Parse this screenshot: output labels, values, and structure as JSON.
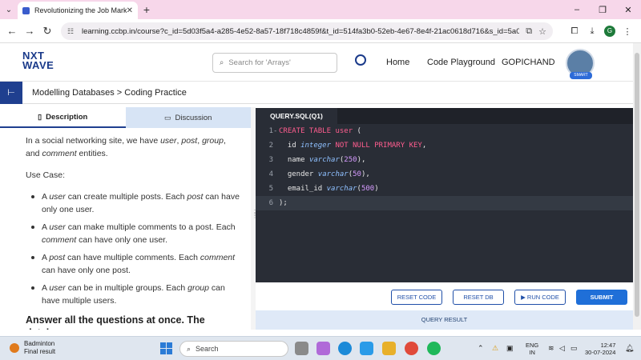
{
  "browser": {
    "tab_title": "Revolutionizing the Job Market",
    "url": "learning.ccbp.in/course?c_id=5d03f5a4-a285-4e52-8a57-18f718c4859f&t_id=514fa3b0-52eb-4e67-8e4f-21ac0618d716&s_id=5a0f436b-85...",
    "profile_initial": "G"
  },
  "header": {
    "logo_line1": "NXT",
    "logo_line2": "WAVE",
    "search_placeholder": "Search for 'Arrays'",
    "nav": [
      "Home",
      "Code Playground",
      "GOPICHAND"
    ],
    "avatar_badge": "SMART"
  },
  "breadcrumb": "Modelling Databases > Coding Practice",
  "left_tabs": [
    "Description",
    "Discussion"
  ],
  "description": {
    "intro_parts": [
      "In a social networking site, we have ",
      "user",
      ", ",
      "post",
      ", ",
      "group",
      ",",
      " and ",
      "comment",
      " entities."
    ],
    "use_case_label": "Use Case:",
    "bullets": [
      [
        "A ",
        "user",
        " can create multiple posts. Each ",
        "post",
        " can have only one user."
      ],
      [
        "A ",
        "user",
        " can make multiple comments to a post. Each ",
        "comment",
        " can have only one user."
      ],
      [
        "A ",
        "post",
        " can have multiple comments. Each ",
        "comment",
        " can have only one post."
      ],
      [
        "A ",
        "user",
        " can be in multiple groups. Each ",
        "group",
        " can have multiple users."
      ]
    ],
    "cut_heading": "Answer all the questions at once. The database"
  },
  "editor": {
    "tab": "QUERY.SQL(Q1)",
    "lines": [
      [
        {
          "t": "CREATE TABLE ",
          "c": "kw"
        },
        {
          "t": "user",
          "c": "kw"
        },
        {
          "t": " (",
          "c": ""
        }
      ],
      [
        {
          "t": "  id ",
          "c": ""
        },
        {
          "t": "integer",
          "c": "ty"
        },
        {
          "t": " NOT NULL PRIMARY KEY",
          "c": "kw"
        },
        {
          "t": ",",
          "c": ""
        }
      ],
      [
        {
          "t": "  name ",
          "c": ""
        },
        {
          "t": "varchar",
          "c": "ty"
        },
        {
          "t": "(",
          "c": ""
        },
        {
          "t": "250",
          "c": "nm"
        },
        {
          "t": "),",
          "c": ""
        }
      ],
      [
        {
          "t": "  gender ",
          "c": ""
        },
        {
          "t": "varchar",
          "c": "ty"
        },
        {
          "t": "(",
          "c": ""
        },
        {
          "t": "50",
          "c": "nm"
        },
        {
          "t": "),",
          "c": ""
        }
      ],
      [
        {
          "t": "  email_id ",
          "c": ""
        },
        {
          "t": "varchar",
          "c": "ty"
        },
        {
          "t": "(",
          "c": ""
        },
        {
          "t": "500",
          "c": "nm"
        },
        {
          "t": ")",
          "c": ""
        }
      ],
      [
        {
          "t": ");",
          "c": ""
        }
      ]
    ]
  },
  "buttons": {
    "reset_code": "RESET CODE",
    "reset_db": "RESET DB",
    "run_code": "RUN CODE",
    "submit": "SUBMIT"
  },
  "query_result": "QUERY RESULT",
  "taskbar": {
    "weather_title": "Badminton",
    "weather_sub": "Final result",
    "search_label": "Search",
    "lang1": "ENG",
    "lang2": "IN",
    "time": "12:47",
    "date": "30-07-2024"
  },
  "colors": {
    "accent": "#1f3f8f",
    "editor_bg": "#292d36",
    "keyword": "#ff5d8f",
    "type": "#8fc0ff",
    "number": "#d69bff"
  }
}
